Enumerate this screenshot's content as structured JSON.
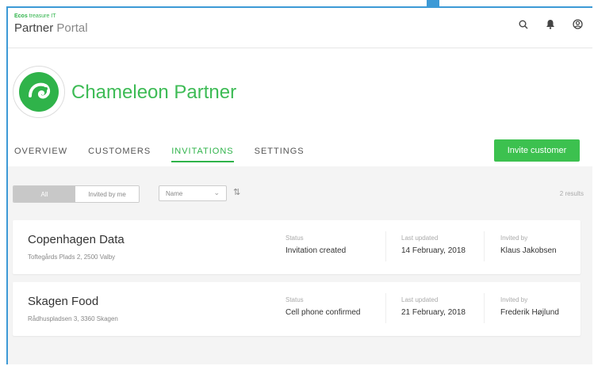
{
  "header": {
    "brand_small": "Ecos",
    "brand_small_rest": "treasure IT",
    "title_bold": "Partner",
    "title_light": "Portal",
    "icons": [
      "search-icon",
      "bell-icon",
      "user-icon"
    ]
  },
  "partner": {
    "name": "Chameleon Partner",
    "logo_icon": "chameleon-logo",
    "brand_color": "#3dbb55"
  },
  "tabs": [
    {
      "label": "OVERVIEW",
      "active": false
    },
    {
      "label": "CUSTOMERS",
      "active": false
    },
    {
      "label": "INVITATIONS",
      "active": true
    },
    {
      "label": "SETTINGS",
      "active": false
    }
  ],
  "invite_button": {
    "label": "Invite customer"
  },
  "filters": {
    "segment": {
      "all": "All",
      "invited_by_me": "Invited by me",
      "selected": "All"
    },
    "sort_by": "Name",
    "results": "2 results"
  },
  "invitations": [
    {
      "name": "Copenhagen Data",
      "address": "Toftegårds Plads 2, 2500 Valby",
      "status_label": "Status",
      "status": "Invitation created",
      "updated_label": "Last updated",
      "updated": "14 February, 2018",
      "invited_by_label": "Invited by",
      "invited_by": "Klaus Jakobsen"
    },
    {
      "name": "Skagen Food",
      "address": "Rådhuspladsen 3, 3360 Skagen",
      "status_label": "Status",
      "status": "Cell phone confirmed",
      "updated_label": "Last updated",
      "updated": "21 February, 2018",
      "invited_by_label": "Invited by",
      "invited_by": "Frederik Højlund"
    }
  ]
}
